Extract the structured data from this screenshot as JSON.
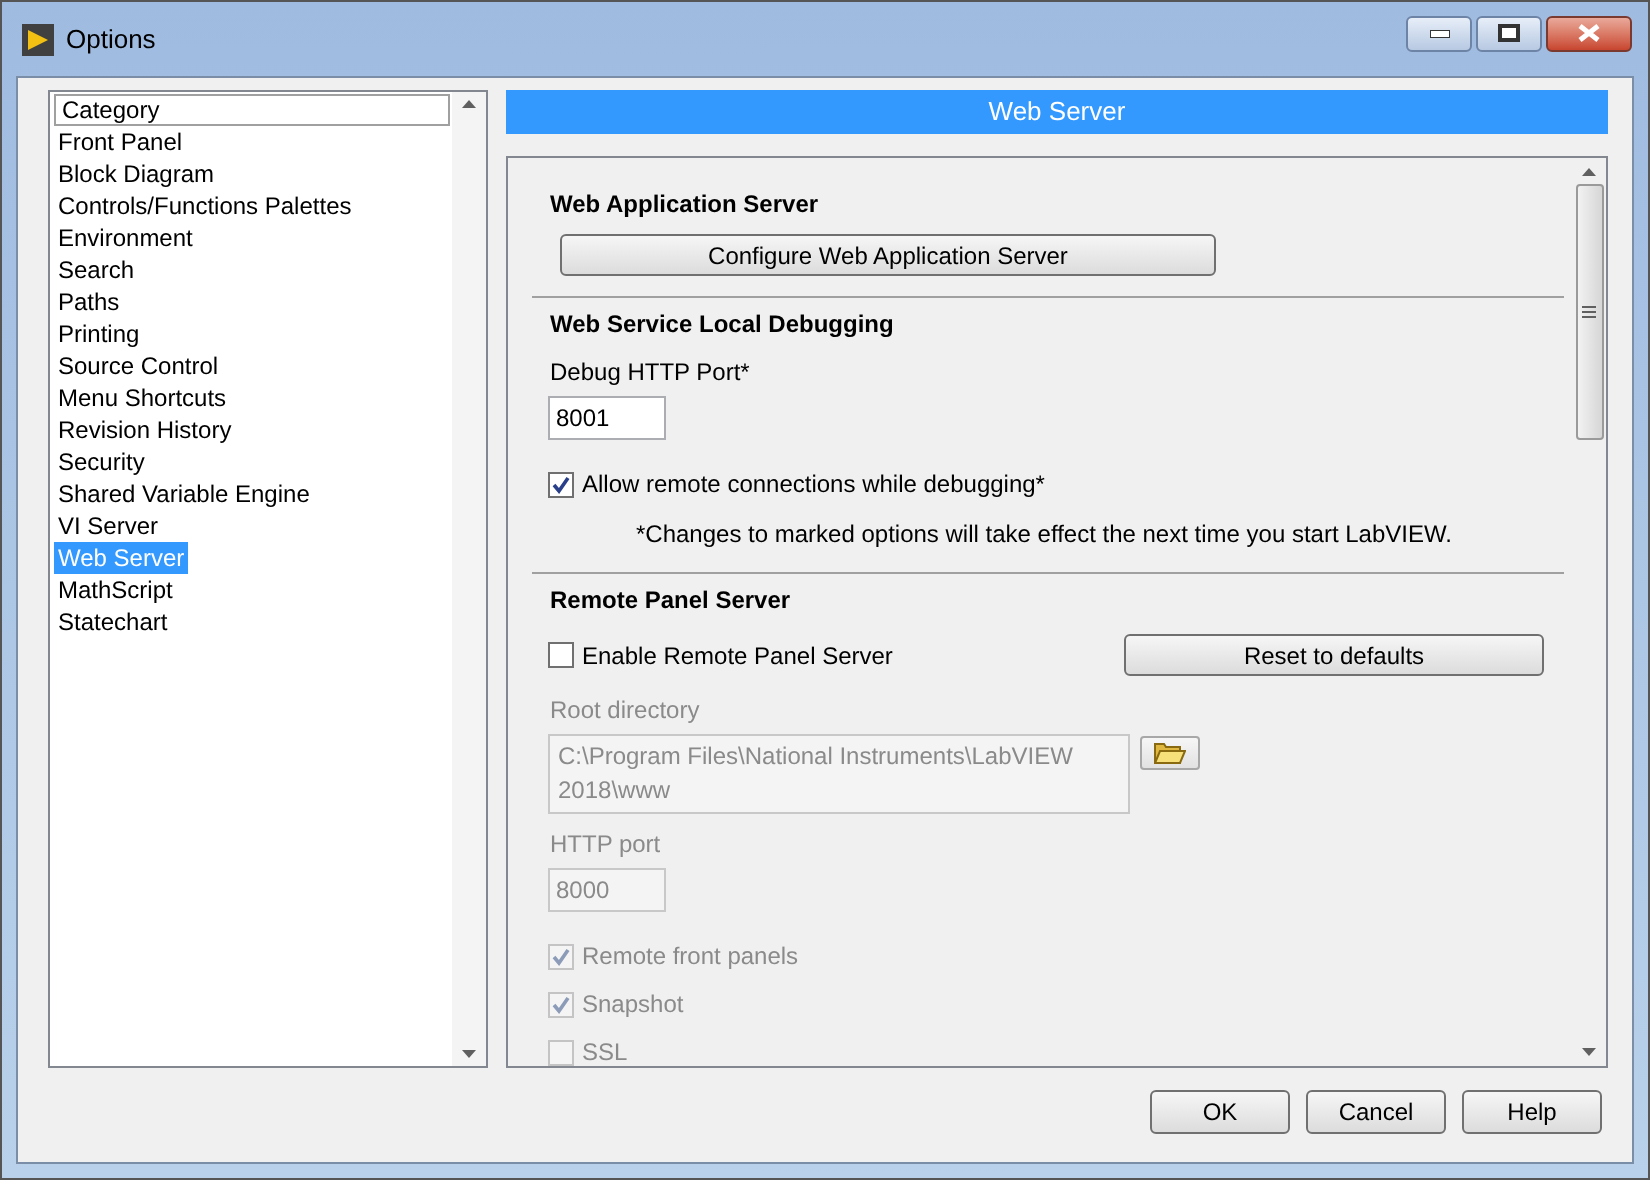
{
  "window": {
    "title": "Options"
  },
  "category_list": {
    "header": "Category",
    "items": [
      {
        "label": "Front Panel",
        "selected": false
      },
      {
        "label": "Block Diagram",
        "selected": false
      },
      {
        "label": "Controls/Functions Palettes",
        "selected": false
      },
      {
        "label": "Environment",
        "selected": false
      },
      {
        "label": "Search",
        "selected": false
      },
      {
        "label": "Paths",
        "selected": false
      },
      {
        "label": "Printing",
        "selected": false
      },
      {
        "label": "Source Control",
        "selected": false
      },
      {
        "label": "Menu Shortcuts",
        "selected": false
      },
      {
        "label": "Revision History",
        "selected": false
      },
      {
        "label": "Security",
        "selected": false
      },
      {
        "label": "Shared Variable Engine",
        "selected": false
      },
      {
        "label": "VI Server",
        "selected": false
      },
      {
        "label": "Web Server",
        "selected": true
      },
      {
        "label": "MathScript",
        "selected": false
      },
      {
        "label": "Statechart",
        "selected": false
      }
    ]
  },
  "page_header": "Web Server",
  "sections": [
    {
      "title": "Web Application Server",
      "items": [
        {
          "kind": "button",
          "label": "Configure Web Application Server"
        }
      ]
    },
    {
      "title": "Web Service Local Debugging",
      "items": [
        {
          "kind": "number_field",
          "label": "Debug HTTP Port*",
          "value": "8001",
          "disabled": false
        },
        {
          "kind": "checkbox",
          "label": "Allow remote connections while debugging*",
          "checked": true,
          "disabled": false
        },
        {
          "kind": "note",
          "text": "*Changes to marked options will take effect the next time you start LabVIEW."
        }
      ]
    },
    {
      "title": "Remote Panel Server",
      "items": [
        {
          "kind": "checkbox_with_button",
          "label": "Enable Remote Panel Server",
          "checked": false,
          "disabled": false,
          "button": "Reset to defaults"
        },
        {
          "kind": "path_field",
          "label": "Root directory",
          "value": "C:\\Program Files\\National Instruments\\LabVIEW 2018\\www",
          "disabled": true
        },
        {
          "kind": "number_field",
          "label": "HTTP port",
          "value": "8000",
          "disabled": true
        },
        {
          "kind": "checkbox",
          "label": "Remote front panels",
          "checked": true,
          "disabled": true
        },
        {
          "kind": "checkbox",
          "label": "Snapshot",
          "checked": true,
          "disabled": true
        },
        {
          "kind": "checkbox",
          "label": "SSL",
          "checked": false,
          "disabled": true
        }
      ]
    }
  ],
  "buttons": [
    "OK",
    "Cancel",
    "Help"
  ]
}
